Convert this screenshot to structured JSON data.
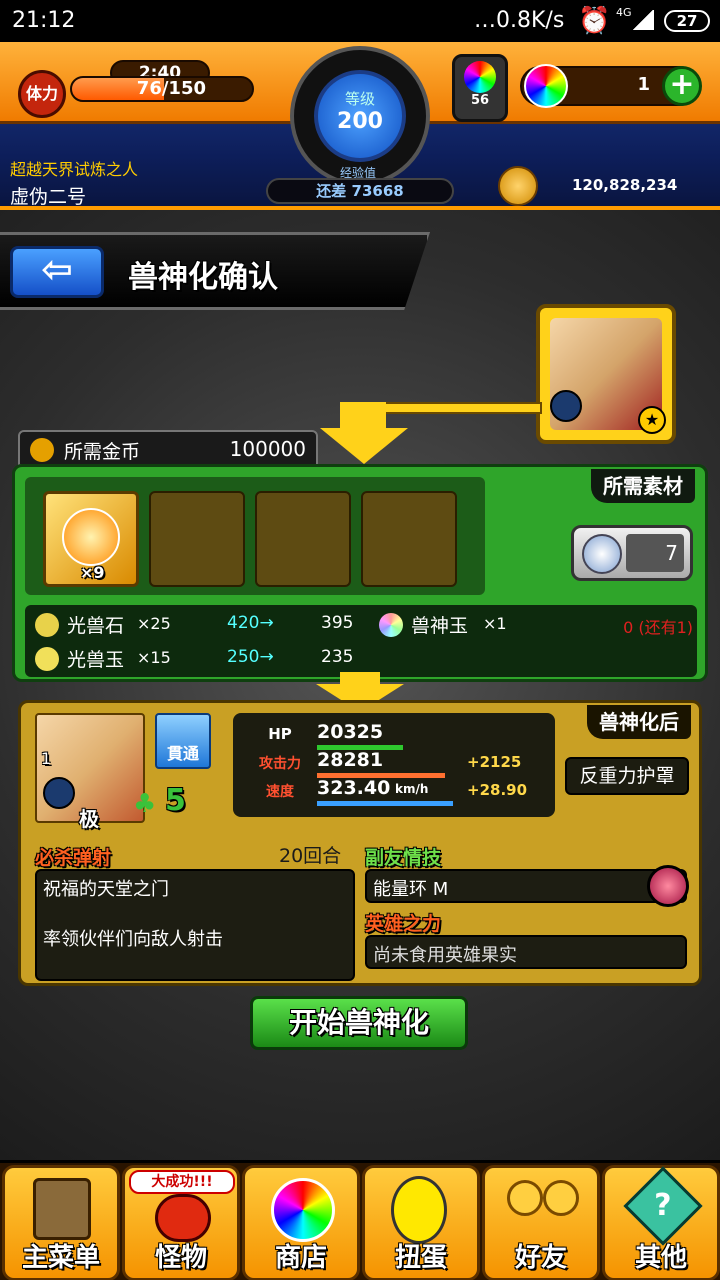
{
  "status_bar": {
    "time": "21:12",
    "network_speed": "…0.8K/s",
    "network_type": "4G",
    "battery": "27"
  },
  "hud": {
    "stamina_label": "体力",
    "stamina_timer": "2:40",
    "stamina_value": "76/150",
    "level_label": "等级",
    "level_value": "200",
    "exp_label": "经验值",
    "exp_remaining": "还差 73668",
    "orb_stock": "56",
    "orb_count": "1",
    "player_title": "超越天界试炼之人",
    "player_name": "虚伪二号",
    "gold": "120,828,234"
  },
  "screen": {
    "title": "兽神化确认"
  },
  "materials": {
    "gold_label": "所需金币",
    "gold_value": "100000",
    "section_label": "所需素材",
    "main_item_count": "×9",
    "side_count": "7",
    "items": [
      {
        "name": "光兽石",
        "qty": "×25",
        "have": "420→",
        "after": "395"
      },
      {
        "name": "光兽玉",
        "qty": "×15",
        "have": "250→",
        "after": "235"
      }
    ],
    "orb_item": {
      "name": "兽神玉",
      "qty": "×1",
      "note": "0 (还有1)"
    }
  },
  "result": {
    "section_label": "兽神化后",
    "char_level": "1",
    "char_grade": "极",
    "luck": "5",
    "gimmick_badge": "貫通",
    "stats": [
      {
        "label": "HP",
        "value": "20325",
        "bonus": ""
      },
      {
        "label": "攻击力",
        "value": "28281",
        "bonus": "+2125"
      },
      {
        "label": "速度",
        "value": "323.40",
        "unit": "km/h",
        "bonus": "+28.90"
      }
    ],
    "ability": "反重力护罩",
    "strike_shot_label": "必杀弹射",
    "strike_turns": "20回合",
    "strike_name": "祝福的天堂之门",
    "strike_desc": "率领伙伴们向敌人射击",
    "friend_label": "副友情技",
    "friend_skill": "能量环 M",
    "hero_label": "英雄之力",
    "hero_desc": "尚未食用英雄果实"
  },
  "action": {
    "start_button": "开始兽神化"
  },
  "bottom_nav": {
    "banner": "大成功!!!",
    "items": [
      "主菜单",
      "怪物",
      "商店",
      "扭蛋",
      "好友",
      "其他"
    ]
  }
}
